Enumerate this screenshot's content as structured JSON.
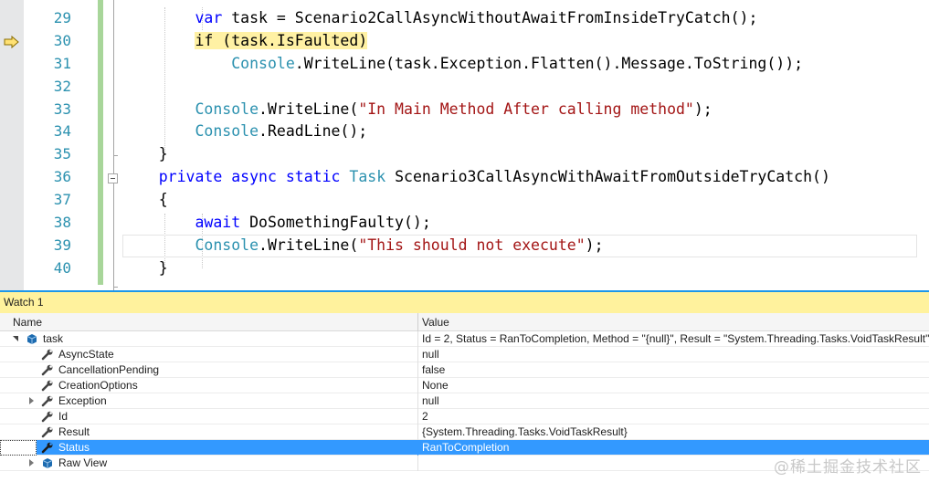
{
  "editor": {
    "line_numbers": [
      "29",
      "30",
      "31",
      "32",
      "33",
      "34",
      "35",
      "36",
      "37",
      "38",
      "39",
      "40"
    ],
    "current_line": "30",
    "lines": [
      [
        {
          "t": "        "
        },
        {
          "t": "var",
          "c": "kw"
        },
        {
          "t": " task = Scenario2CallAsyncWithoutAwaitFromInsideTryCatch();"
        }
      ],
      [
        {
          "t": "        "
        },
        {
          "t": "if (task.IsFaulted)",
          "c": "hl"
        }
      ],
      [
        {
          "t": "            "
        },
        {
          "t": "Console",
          "c": "ty"
        },
        {
          "t": ".WriteLine(task.Exception.Flatten().Message.ToString());"
        }
      ],
      [
        {
          "t": ""
        }
      ],
      [
        {
          "t": "        "
        },
        {
          "t": "Console",
          "c": "ty"
        },
        {
          "t": ".WriteLine("
        },
        {
          "t": "\"In Main Method After calling method\"",
          "c": "st"
        },
        {
          "t": ");"
        }
      ],
      [
        {
          "t": "        "
        },
        {
          "t": "Console",
          "c": "ty"
        },
        {
          "t": ".ReadLine();"
        }
      ],
      [
        {
          "t": "    }"
        }
      ],
      [
        {
          "t": "    "
        },
        {
          "t": "private",
          "c": "kw"
        },
        {
          "t": " "
        },
        {
          "t": "async",
          "c": "kw"
        },
        {
          "t": " "
        },
        {
          "t": "static",
          "c": "kw"
        },
        {
          "t": " "
        },
        {
          "t": "Task",
          "c": "ty"
        },
        {
          "t": " Scenario3CallAsyncWithAwaitFromOutsideTryCatch()"
        }
      ],
      [
        {
          "t": "    {"
        }
      ],
      [
        {
          "t": "        "
        },
        {
          "t": "await",
          "c": "kw"
        },
        {
          "t": " DoSomethingFaulty();"
        }
      ],
      [
        {
          "t": "        "
        },
        {
          "t": "Console",
          "c": "ty"
        },
        {
          "t": ".WriteLine("
        },
        {
          "t": "\"This should not execute\"",
          "c": "st"
        },
        {
          "t": ");"
        }
      ],
      [
        {
          "t": "    }"
        }
      ]
    ]
  },
  "watch": {
    "title": "Watch 1",
    "col_name": "Name",
    "col_value": "Value",
    "rows": [
      {
        "name": "task",
        "value": "Id = 2, Status = RanToCompletion, Method = \"{null}\", Result = \"System.Threading.Tasks.VoidTaskResult\"",
        "icon": "object-icon",
        "depth": 0,
        "expander": "open"
      },
      {
        "name": "AsyncState",
        "value": "null",
        "icon": "property-icon",
        "depth": 1,
        "expander": "none"
      },
      {
        "name": "CancellationPending",
        "value": "false",
        "icon": "property-icon",
        "depth": 1,
        "expander": "none"
      },
      {
        "name": "CreationOptions",
        "value": "None",
        "icon": "property-icon",
        "depth": 1,
        "expander": "none"
      },
      {
        "name": "Exception",
        "value": "null",
        "icon": "property-icon",
        "depth": 1,
        "expander": "closed"
      },
      {
        "name": "Id",
        "value": "2",
        "icon": "property-icon",
        "depth": 1,
        "expander": "none"
      },
      {
        "name": "Result",
        "value": "{System.Threading.Tasks.VoidTaskResult}",
        "icon": "property-icon",
        "depth": 1,
        "expander": "none"
      },
      {
        "name": "Status",
        "value": "RanToCompletion",
        "icon": "property-icon",
        "depth": 1,
        "expander": "none",
        "selected": true
      },
      {
        "name": "Raw View",
        "value": "",
        "icon": "object-icon",
        "depth": 1,
        "expander": "closed"
      }
    ]
  },
  "watermark": "@稀土掘金技术社区",
  "colors": {
    "keyword": "#0000ff",
    "type": "#2b91af",
    "string": "#a31515",
    "highlight": "#fff1a4",
    "selection": "#3399ff",
    "title_bar": "#fff29d"
  }
}
